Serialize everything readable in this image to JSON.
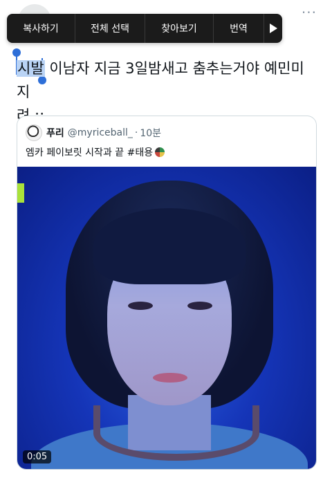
{
  "context_menu": {
    "items": [
      "복사하기",
      "전체 선택",
      "찾아보기",
      "번역"
    ],
    "more_icon": "play-arrow-icon"
  },
  "tweet": {
    "selected_text": "시발",
    "rest_line1": " 이남자 지금 3일밤새고 춤추는거야 예민미 지",
    "line2": "려 ;;"
  },
  "quote": {
    "name": "푸리",
    "handle": "@myriceball_",
    "dot": "·",
    "time": "10분",
    "text": "엠카 페이보릿 시작과 끝 #태용",
    "emoji": "nct-badge-icon"
  },
  "video": {
    "timer": "0:05"
  },
  "colors": {
    "menu_bg": "#1b1b1b",
    "selection": "#b9d3f5",
    "handle": "#2e6fd8",
    "video_bg": "#1535b8"
  }
}
